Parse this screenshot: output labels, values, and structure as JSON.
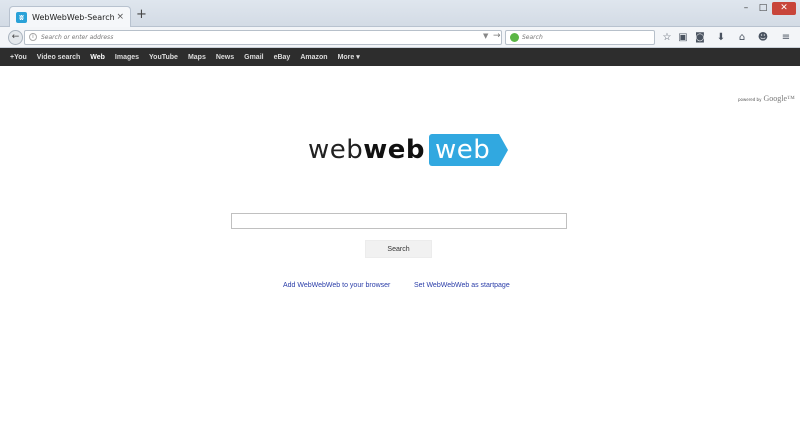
{
  "window": {
    "tab_title": "WebWebWeb-Search",
    "tab_favicon": "webwebweb-favicon",
    "tab_close_icon": "×",
    "new_tab_icon": "+",
    "min_icon": "–",
    "max_icon": "□",
    "close_icon": "✕"
  },
  "navbar": {
    "back_icon": "←",
    "url_placeholder": "Search or enter address",
    "url_info_icon": "i",
    "url_dropdown_icon": "▼",
    "url_go_icon": "→",
    "search_placeholder": "Search",
    "toolbar_icons": {
      "bookmark": "☆",
      "clipboard": "▣",
      "pocket": "◙",
      "download": "⬇",
      "home": "⌂",
      "sync": "☻",
      "menu": "≡"
    }
  },
  "menubar": {
    "items": [
      {
        "label": "+You",
        "active": false
      },
      {
        "label": "Video search",
        "active": false
      },
      {
        "label": "Web",
        "active": true
      },
      {
        "label": "Images",
        "active": false
      },
      {
        "label": "YouTube",
        "active": false
      },
      {
        "label": "Maps",
        "active": false
      },
      {
        "label": "News",
        "active": false
      },
      {
        "label": "Gmail",
        "active": false
      },
      {
        "label": "eBay",
        "active": false
      },
      {
        "label": "Amazon",
        "active": false
      },
      {
        "label": "More ▾",
        "active": false
      }
    ]
  },
  "powered_by": {
    "text": "powered by",
    "brand": "Google™"
  },
  "logo": {
    "part1": "web",
    "part2": "web",
    "part3": "web",
    "badge_color": "#31a8e0"
  },
  "main": {
    "search_value": "",
    "search_button": "Search",
    "link_add": "Add WebWebWeb to your browser",
    "link_set": "Set WebWebWeb as startpage"
  },
  "colors": {
    "menubar_bg": "#2d2d2d",
    "link": "#2a3da8",
    "accent": "#31a8e0"
  }
}
